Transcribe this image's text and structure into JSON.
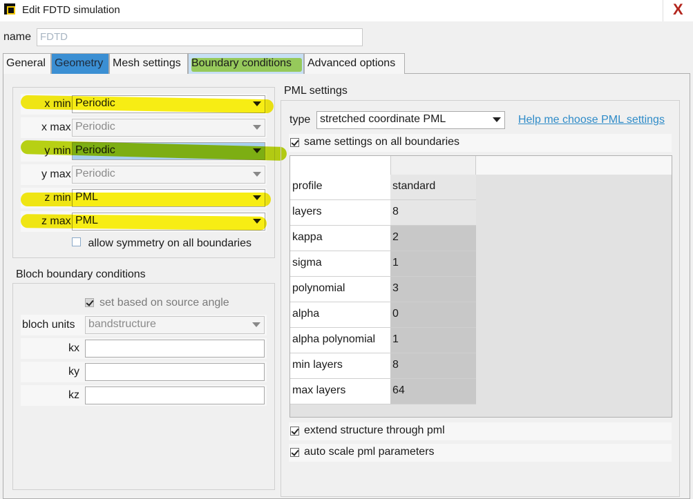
{
  "window": {
    "title": "Edit FDTD simulation",
    "close_glyph": "X"
  },
  "name": {
    "label": "name",
    "value": "FDTD"
  },
  "tabs": [
    {
      "label": "General"
    },
    {
      "label": "Geometry"
    },
    {
      "label": "Mesh settings"
    },
    {
      "label": "Boundary conditions"
    },
    {
      "label": "Advanced options"
    }
  ],
  "boundaries": [
    {
      "label": "x min bc",
      "value": "Periodic",
      "enabled": true
    },
    {
      "label": "x max bc",
      "value": "Periodic",
      "enabled": false
    },
    {
      "label": "y min bc",
      "value": "Periodic",
      "enabled": true
    },
    {
      "label": "y max bc",
      "value": "Periodic",
      "enabled": false
    },
    {
      "label": "z min bc",
      "value": "PML",
      "enabled": true
    },
    {
      "label": "z max bc",
      "value": "PML",
      "enabled": true
    }
  ],
  "symmetry": {
    "label": "allow symmetry on all boundaries",
    "checked": false
  },
  "bloch": {
    "title": "Bloch boundary conditions",
    "source_angle_label": "set based on source angle",
    "source_angle_checked": true,
    "units_label": "bloch units",
    "units_value": "bandstructure",
    "kx_label": "kx",
    "kx_value": "",
    "ky_label": "ky",
    "ky_value": "",
    "kz_label": "kz",
    "kz_value": ""
  },
  "pml": {
    "title": "PML settings",
    "type_label": "type",
    "type_value": "stretched coordinate PML",
    "help_link": "Help me choose PML settings",
    "same_settings_label": "same settings on all boundaries",
    "same_settings_checked": true,
    "rows": [
      {
        "name": "profile",
        "value": "standard"
      },
      {
        "name": "layers",
        "value": "8"
      },
      {
        "name": "kappa",
        "value": "2"
      },
      {
        "name": "sigma",
        "value": "1"
      },
      {
        "name": "polynomial",
        "value": "3"
      },
      {
        "name": "alpha",
        "value": "0"
      },
      {
        "name": "alpha polynomial",
        "value": "1"
      },
      {
        "name": "min layers",
        "value": "8"
      },
      {
        "name": "max layers",
        "value": "64"
      }
    ],
    "extend_label": "extend structure through pml",
    "extend_checked": true,
    "autoscale_label": "auto scale pml parameters",
    "autoscale_checked": true
  },
  "colors": {
    "highlight_yellow": "#f7ec00",
    "highlight_green": "#b8d400",
    "tab_selected": "#3b8fd3",
    "link": "#2e8bc8"
  }
}
